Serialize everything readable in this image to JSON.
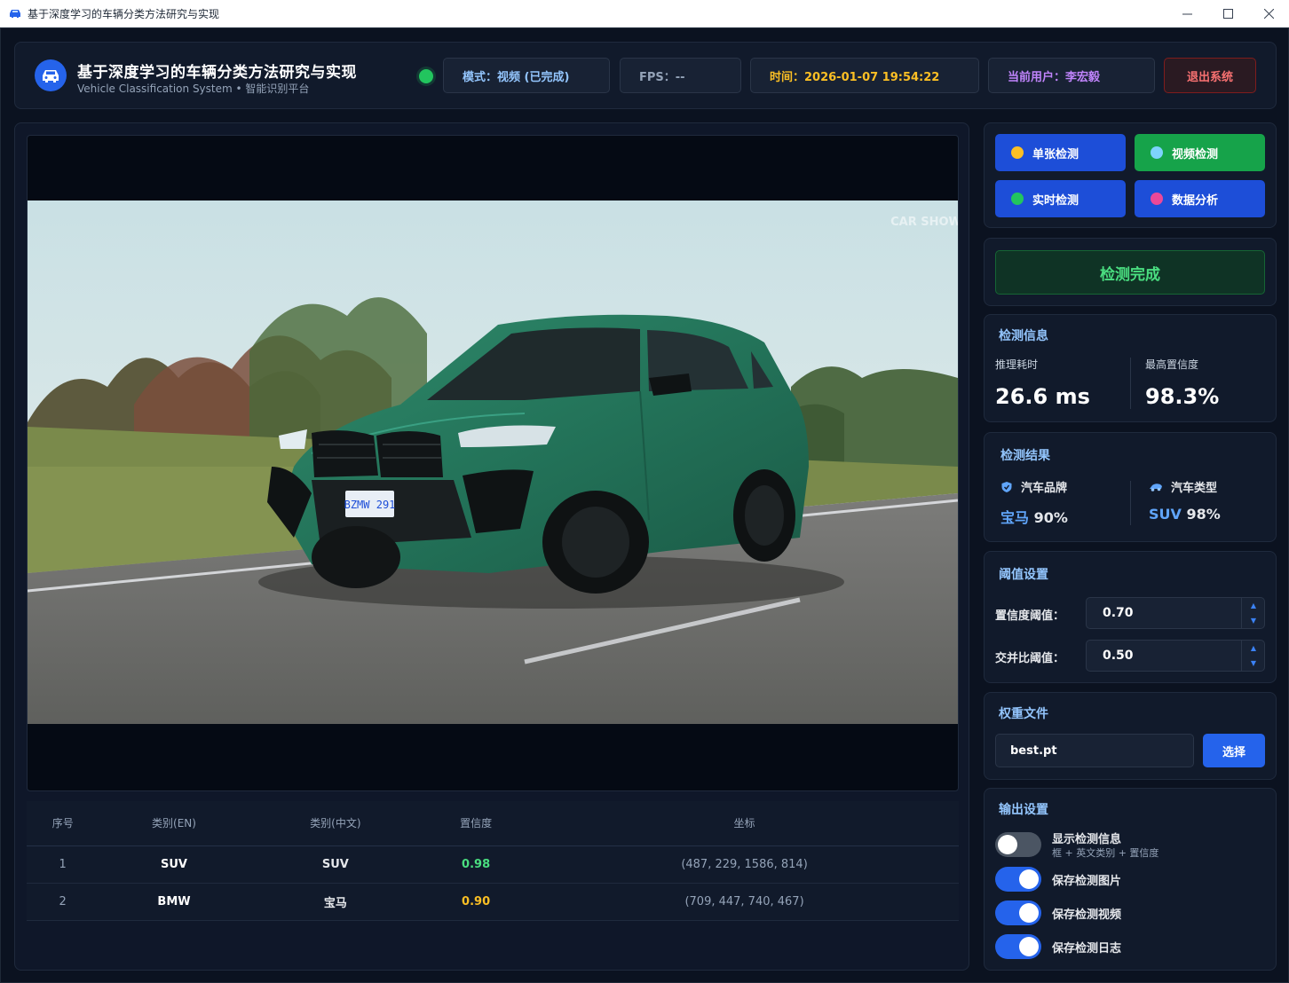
{
  "window": {
    "title": "基于深度学习的车辆分类方法研究与实现"
  },
  "header": {
    "title": "基于深度学习的车辆分类方法研究与实现",
    "subtitle": "Vehicle Classification System • 智能识别平台",
    "mode": "模式：视频 (已完成)",
    "fps": "FPS：--",
    "time": "时间：2026-01-07 19:54:22",
    "user": "当前用户：李宏毅",
    "logout_label": "退出系统",
    "status_color": "#22c55e"
  },
  "video": {
    "watermark": "CAR SHOW",
    "plate": "BZMW 291"
  },
  "table": {
    "headers": [
      "序号",
      "类别(EN)",
      "类别(中文)",
      "置信度",
      "坐标"
    ],
    "rows": [
      {
        "idx": "1",
        "en": "SUV",
        "cn": "SUV",
        "conf": "0.98",
        "coords": "(487, 229, 1586, 814)"
      },
      {
        "idx": "2",
        "en": "BMW",
        "cn": "宝马",
        "conf": "0.90",
        "coords": "(709, 447, 740, 467)"
      }
    ]
  },
  "modes": [
    {
      "label": "单张检测",
      "dot_color": "#fbbf24",
      "icon": "dot-icon"
    },
    {
      "label": "视频检测",
      "dot_color": "#7dd3fc",
      "icon": "dot-icon"
    },
    {
      "label": "实时检测",
      "dot_color": "#22c55e",
      "icon": "dot-icon"
    },
    {
      "label": "数据分析",
      "dot_color": "#ec4899",
      "icon": "dot-icon"
    }
  ],
  "status": {
    "text": "检测完成"
  },
  "info": {
    "title": "检测信息",
    "inference_label": "推理耗时",
    "inference_value": "26.6 ms",
    "max_conf_label": "最高置信度",
    "max_conf_value": "98.3%"
  },
  "result": {
    "title": "检测结果",
    "brand_label": "汽车品牌",
    "brand_value": "宝马",
    "brand_pct": "90%",
    "type_label": "汽车类型",
    "type_value": "SUV",
    "type_pct": "98%"
  },
  "threshold": {
    "title": "阈值设置",
    "conf_label": "置信度阈值：",
    "conf_value": "0.70",
    "iou_label": "交并比阈值：",
    "iou_value": "0.50"
  },
  "weights": {
    "title": "权重文件",
    "file": "best.pt",
    "choose_label": "选择"
  },
  "output": {
    "title": "输出设置",
    "show_info_label": "显示检测信息",
    "show_info_sub": "框 + 英文类别 + 置信度",
    "show_info_on": false,
    "save_image_label": "保存检测图片",
    "save_image_on": true,
    "save_video_label": "保存检测视频",
    "save_video_on": true,
    "save_log_label": "保存检测日志",
    "save_log_on": true
  }
}
